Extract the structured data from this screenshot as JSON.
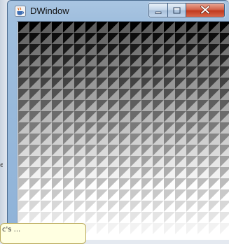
{
  "window": {
    "title": "DWindow",
    "icon": "java-cup-icon",
    "controls": {
      "minimize_icon": "minimize-icon",
      "maximize_icon": "maximize-icon",
      "close_icon": "close-icon"
    }
  },
  "pattern": {
    "rows": 20,
    "cols": 19,
    "dark_color": "#000000",
    "light_color": "#ffffff",
    "description_of_fill": "each cell split diagonally; upper-left triangle shaded, lower-right triangle lighter; shading lightens row by row from black at top to white at bottom"
  },
  "background": {
    "left_fragment": "e",
    "tooltip_fragment": "c's ..."
  },
  "colors": {
    "title_bar": "#9fbedd",
    "close_button": "#c0391e",
    "tooltip_bg": "#ffffe1"
  }
}
